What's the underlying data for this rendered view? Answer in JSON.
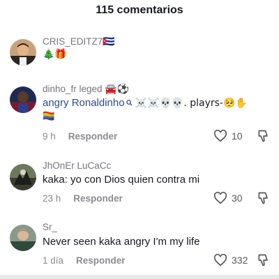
{
  "header": {
    "title": "115 comentarios"
  },
  "comments": [
    {
      "username": "CRIS_EDITZ7",
      "username_suffix": "🇨🇺",
      "text": "🎄🎁"
    },
    {
      "username": "dinho_fr leged",
      "username_suffix": "🚘⚽",
      "mention": "angry Ronaldinho",
      "mention_icon": "search-icon",
      "text": "☠️☠️💀💀. playrs-🥺✋",
      "text_line2": "🏳️‍🌈",
      "time": "9 h",
      "reply_label": "Responder",
      "likes": "10"
    },
    {
      "username": "JhOnEr LuCaCc",
      "text": "kaka: yo con Dios quien contra mi",
      "time": "23 h",
      "reply_label": "Responder",
      "likes": "30"
    },
    {
      "username": "Sr_",
      "text": "Never seen kaka angry I'm my life",
      "time": "1 día",
      "reply_label": "Responder",
      "likes": "332"
    }
  ],
  "colors": {
    "text": "#161823",
    "muted": "#8a8b91",
    "mention": "#2b4b8c"
  }
}
